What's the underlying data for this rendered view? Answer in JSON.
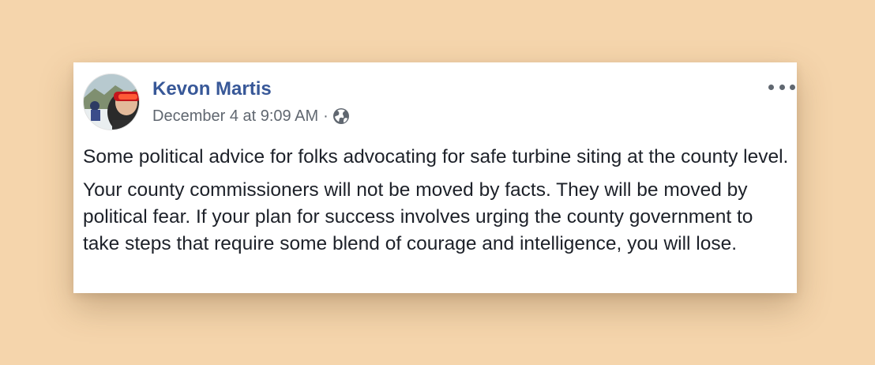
{
  "post": {
    "author_name": "Kevon Martis",
    "timestamp": "December 4 at 9:09 AM",
    "separator": "·",
    "privacy_icon": "globe-icon",
    "more_icon": "more-options-icon",
    "paragraphs": [
      "Some political advice for folks advocating for safe turbine siting at the county level.",
      "Your county commissioners will not be moved by facts. They will be moved by political fear. If your plan for success involves urging the county government to take steps that require some blend of courage and intelligence, you will lose."
    ]
  },
  "colors": {
    "background": "#f5d5ac",
    "card": "#ffffff",
    "author_link": "#385898",
    "meta_text": "#606770",
    "body_text": "#1d2129"
  }
}
